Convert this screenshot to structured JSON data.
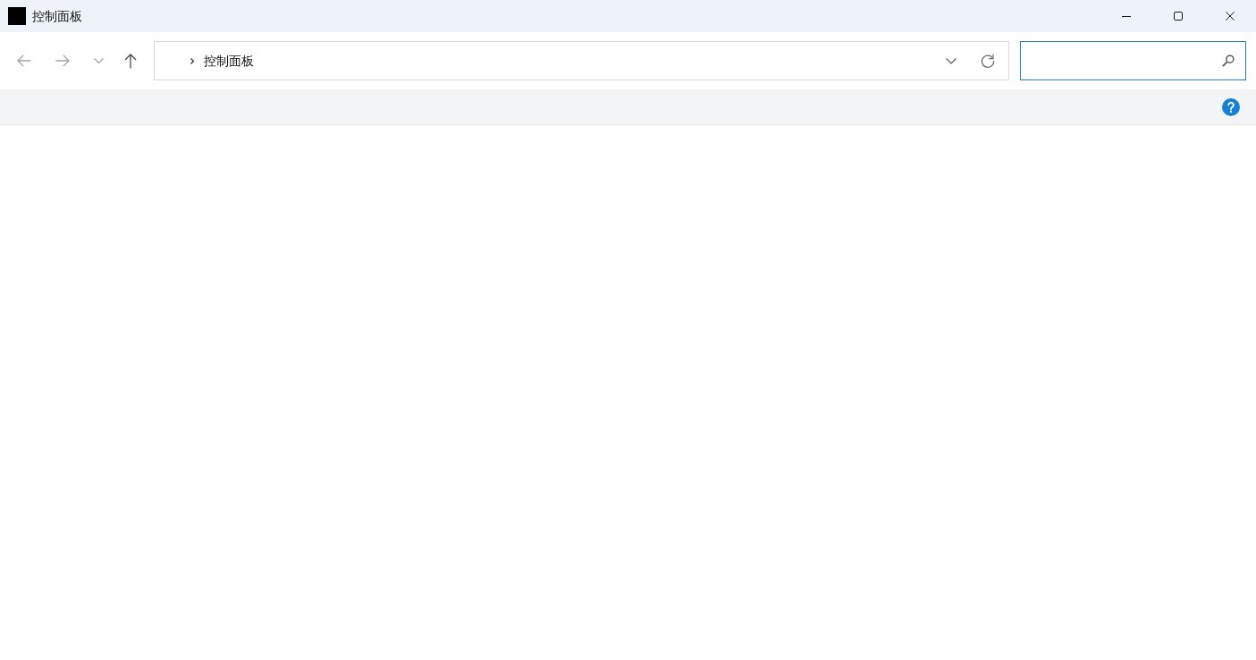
{
  "window": {
    "title": "控制面板"
  },
  "navigation": {
    "buttons": [
      {
        "kind": "back",
        "disabled": true
      },
      {
        "kind": "forward",
        "disabled": true
      },
      {
        "kind": "recent",
        "disabled": true
      },
      {
        "kind": "up",
        "disabled": false
      }
    ]
  },
  "address_bar": {
    "path": [
      "控制面板"
    ]
  },
  "search": {
    "focused": true
  }
}
